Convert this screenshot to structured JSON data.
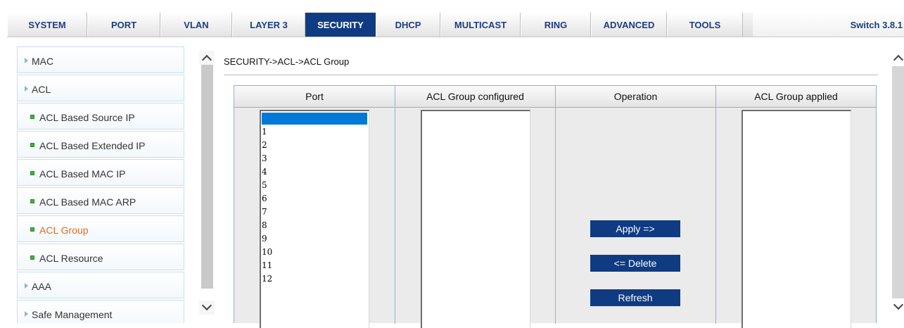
{
  "nav": {
    "tabs": [
      {
        "label": "SYSTEM"
      },
      {
        "label": "PORT"
      },
      {
        "label": "VLAN"
      },
      {
        "label": "LAYER 3"
      },
      {
        "label": "SECURITY"
      },
      {
        "label": "DHCP"
      },
      {
        "label": "MULTICAST"
      },
      {
        "label": "RING"
      },
      {
        "label": "ADVANCED"
      },
      {
        "label": "TOOLS"
      }
    ],
    "active_tab": "SECURITY",
    "version": "Switch 3.8.1"
  },
  "sidebar": {
    "items": [
      {
        "label": "MAC"
      },
      {
        "label": "ACL"
      },
      {
        "label": "ACL Based Source IP"
      },
      {
        "label": "ACL Based Extended IP"
      },
      {
        "label": "ACL Based MAC IP"
      },
      {
        "label": "ACL Based MAC ARP"
      },
      {
        "label": "ACL Group"
      },
      {
        "label": "ACL Resource"
      },
      {
        "label": "AAA"
      },
      {
        "label": "Safe Management"
      }
    ],
    "current_item": "ACL Group"
  },
  "main": {
    "breadcrumb": "SECURITY->ACL->ACL Group",
    "columns": {
      "port": "Port",
      "configured": "ACL Group configured",
      "operation": "Operation",
      "applied": "ACL Group applied"
    },
    "ports": [
      "1",
      "2",
      "3",
      "4",
      "5",
      "6",
      "7",
      "8",
      "9",
      "10",
      "11",
      "12"
    ],
    "buttons": {
      "apply": "Apply =>",
      "delete": "<= Delete",
      "refresh": "Refresh"
    }
  },
  "colors": {
    "accent": "#0f3b83",
    "nav_text": "#1c3d80",
    "current_item": "#e86a1b",
    "bullet": "#3fb23f",
    "selection": "#0078d7"
  }
}
